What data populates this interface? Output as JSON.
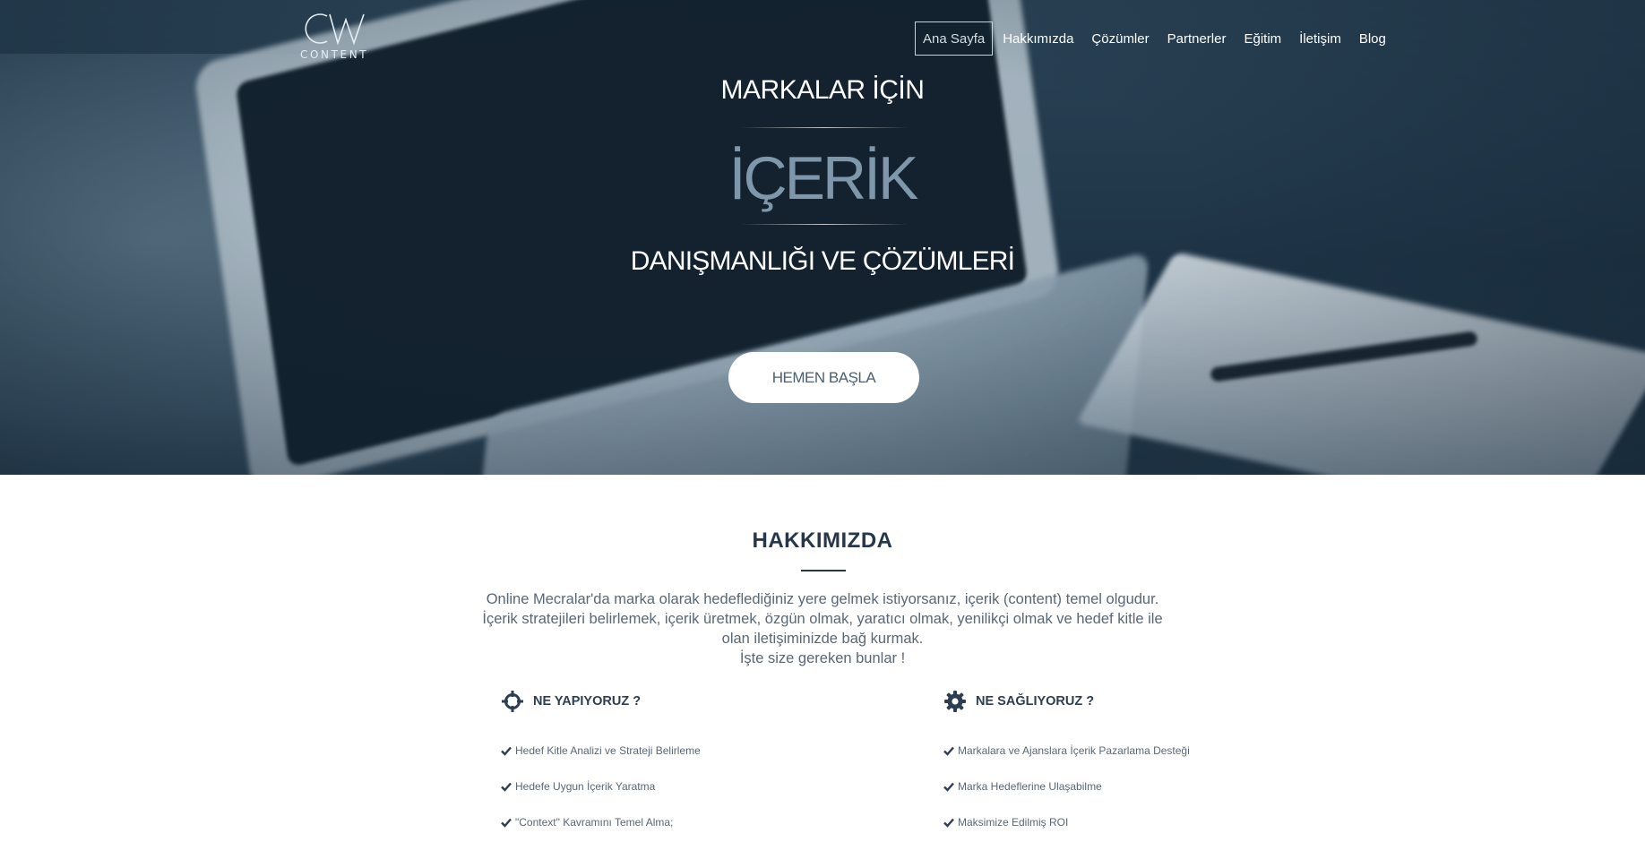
{
  "brand": {
    "logo_letters": "CW",
    "logo_word": "CONTENT"
  },
  "nav": {
    "items": [
      {
        "label": "Ana Sayfa",
        "active": true
      },
      {
        "label": "Hakkımızda"
      },
      {
        "label": "Çözümler"
      },
      {
        "label": "Partnerler"
      },
      {
        "label": "Eğitim"
      },
      {
        "label": "İletişim"
      },
      {
        "label": "Blog"
      }
    ]
  },
  "hero": {
    "line1": "MARKALAR İÇİN",
    "line2": "İÇERİK",
    "line3": "DANIŞMANLIĞI VE ÇÖZÜMLERİ",
    "cta_label": "HEMEN BAŞLA"
  },
  "about": {
    "title": "HAKKIMIZDA",
    "paragraph": [
      "Online Mecralar'da marka olarak hedeflediğiniz yere gelmek istiyorsanız, içerik (content) temel olgudur.",
      "İçerik stratejileri belirlemek, içerik üretmek, özgün olmak, yaratıcı olmak, yenilikçi olmak ve hedef kitle ile",
      "olan iletişiminizde bağ kurmak.",
      "İşte size gereken bunlar !"
    ],
    "features": [
      {
        "icon": "crosshair-icon",
        "title": "NE YAPIYORUZ ?",
        "items": [
          "Hedef Kitle Analizi ve Strateji Belirleme",
          "Hedefe Uygun İçerik Yaratma",
          "\"Context\" Kavramını Temel Alma;"
        ]
      },
      {
        "icon": "gear-icon",
        "title": "NE SAĞLIYORUZ ?",
        "items": [
          "Markalara ve Ajanslara İçerik Pazarlama Desteği",
          "Marka Hedeflerine Ulaşabilme",
          "Maksimize Edilmiş ROI"
        ]
      }
    ]
  },
  "colors": {
    "hero_overlay": "#1e3446",
    "accent_text": "#7e97ab",
    "heading": "#27374a",
    "body_text": "#5a6776"
  }
}
